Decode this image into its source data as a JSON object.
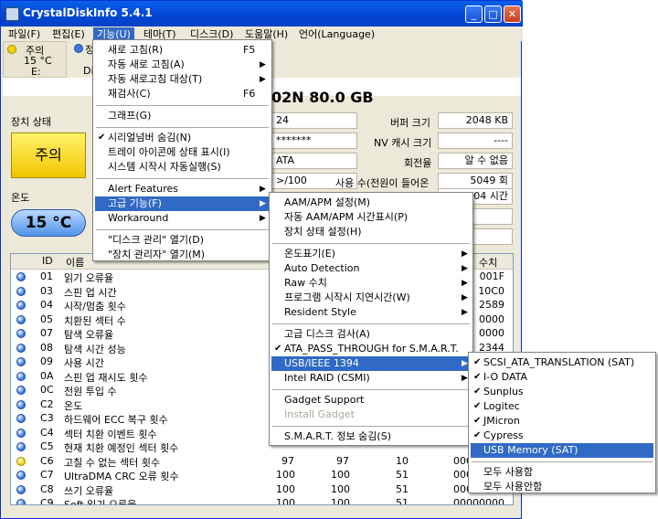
{
  "window": {
    "title": "CrystalDiskInfo 5.4.1",
    "minimize": "_",
    "maximize": "□",
    "close": "✕"
  },
  "menubar": [
    "파일(F)",
    "편집(E)",
    "기능(U)",
    "테마(T)",
    "디스크(D)",
    "도움말(H)",
    "언어(Language)"
  ],
  "disk_tabs": [
    {
      "status": "주의",
      "temp": "15 °C",
      "drive": "E:",
      "color": "#f5d000"
    },
    {
      "status": "정",
      "drive": "Di",
      "color": "#3a78e8"
    }
  ],
  "disk_title": "02N  80.0 GB",
  "left_panel": {
    "health_label": "장치 상태",
    "health_value": "주의",
    "temp_label": "온도",
    "temp_value": "15 °C"
  },
  "info_fields": {
    "col1": [
      "24",
      "*******",
      "ATA",
      ">/100"
    ],
    "col2_labels": [
      "버퍼 크기",
      "NV 캐시 크기",
      "회전율",
      "사용 수(전원이 들어온"
    ],
    "col2_values": [
      "2048 KB",
      "----",
      "알 수 없음",
      "5049 회"
    ],
    "partial_value": "04 시간"
  },
  "table": {
    "headers": [
      "ID",
      "이름",
      "수치"
    ],
    "rows": [
      {
        "id": "01",
        "name": "읽기 오류율",
        "raw": "001F",
        "color": "blue"
      },
      {
        "id": "03",
        "name": "스핀 업 시간",
        "raw": "10C0",
        "color": "blue"
      },
      {
        "id": "04",
        "name": "시작/멈춤 횟수",
        "raw": "2589",
        "color": "blue"
      },
      {
        "id": "05",
        "name": "치환된 섹터 수",
        "raw": "0000",
        "color": "blue"
      },
      {
        "id": "07",
        "name": "탐색 오류율",
        "raw": "0000",
        "color": "blue"
      },
      {
        "id": "08",
        "name": "탐색 시간 성능",
        "raw": "2344",
        "color": "blue"
      },
      {
        "id": "09",
        "name": "사용 시간",
        "raw": "",
        "color": "blue"
      },
      {
        "id": "0A",
        "name": "스핀 업 재시도 횟수",
        "raw": "",
        "color": "blue"
      },
      {
        "id": "0C",
        "name": "전원 투입 수",
        "raw": "",
        "color": "blue"
      },
      {
        "id": "C2",
        "name": "온도",
        "raw": "",
        "color": "blue"
      },
      {
        "id": "C3",
        "name": "하드웨어 ECC 복구 횟수",
        "raw": "",
        "color": "blue"
      },
      {
        "id": "C4",
        "name": "섹터 치환 이벤트 횟수",
        "raw": "",
        "color": "blue"
      },
      {
        "id": "C5",
        "name": "현재 치환 예정인 섹터 횟수",
        "raw": "",
        "color": "blue"
      },
      {
        "id": "C6",
        "name": "고칠 수 없는 섹터 횟수",
        "cur": "97",
        "worst": "97",
        "thr": "10",
        "raw": "00000000",
        "color": "yellow"
      },
      {
        "id": "C7",
        "name": "UltraDMA CRC 오류 횟수",
        "cur": "100",
        "worst": "100",
        "thr": "51",
        "raw": "00000000",
        "color": "blue"
      },
      {
        "id": "C8",
        "name": "쓰기 오류율",
        "cur": "100",
        "worst": "100",
        "thr": "51",
        "raw": "00000000",
        "color": "blue"
      },
      {
        "id": "C9",
        "name": "Soft 읽기 오류율",
        "cur": "100",
        "worst": "100",
        "thr": "51",
        "raw": "00000000",
        "color": "blue"
      }
    ]
  },
  "menu_func": [
    {
      "label": "새로 고침(R)",
      "shortcut": "F5"
    },
    {
      "label": "자동 새로 고침(A)",
      "arrow": true
    },
    {
      "label": "자동 새로고침 대상(T)",
      "arrow": true
    },
    {
      "label": "재검사(C)",
      "shortcut": "F6"
    },
    {
      "sep": true
    },
    {
      "label": "그래프(G)"
    },
    {
      "sep": true
    },
    {
      "label": "시리얼넘버 숨김(N)",
      "check": true
    },
    {
      "label": "트레이 아이콘에 상태 표시(I)"
    },
    {
      "label": "시스템 시작시 자동실행(S)"
    },
    {
      "sep": true
    },
    {
      "label": "Alert Features",
      "arrow": true
    },
    {
      "label": "고급 기능(F)",
      "arrow": true,
      "highlight": true
    },
    {
      "label": "Workaround",
      "arrow": true
    },
    {
      "sep": true
    },
    {
      "label": "\"디스크 관리\" 열기(D)"
    },
    {
      "label": "\"장치 관리자\" 열기(M)"
    }
  ],
  "menu_advanced": [
    {
      "label": "AAM/APM 설정(M)"
    },
    {
      "label": "자동 AAM/APM 시간표시(P)"
    },
    {
      "label": "장치 상태 설정(H)"
    },
    {
      "sep": true
    },
    {
      "label": "온도표기(E)",
      "arrow": true
    },
    {
      "label": "Auto Detection",
      "arrow": true
    },
    {
      "label": "Raw 수치",
      "arrow": true
    },
    {
      "label": "프로그램 시작시 지연시간(W)",
      "arrow": true
    },
    {
      "label": "Resident Style",
      "arrow": true
    },
    {
      "sep": true
    },
    {
      "label": "고급 디스크 검사(A)"
    },
    {
      "label": "ATA_PASS_THROUGH for S.M.A.R.T.",
      "check": true
    },
    {
      "label": "USB/IEEE 1394",
      "arrow": true,
      "highlight": true
    },
    {
      "label": "Intel RAID (CSMI)",
      "arrow": true
    },
    {
      "sep": true
    },
    {
      "label": "Gadget Support"
    },
    {
      "label": "Install Gadget",
      "disabled": true
    },
    {
      "sep": true
    },
    {
      "label": "S.M.A.R.T. 정보 숨김(S)"
    }
  ],
  "menu_usb": [
    {
      "label": "SCSI_ATA_TRANSLATION (SAT)",
      "check": true
    },
    {
      "label": "I-O DATA",
      "check": true
    },
    {
      "label": "Sunplus",
      "check": true
    },
    {
      "label": "Logitec",
      "check": true
    },
    {
      "label": "JMicron",
      "check": true
    },
    {
      "label": "Cypress",
      "check": true
    },
    {
      "label": "USB Memory (SAT)",
      "highlight": true
    },
    {
      "sep": true
    },
    {
      "label": "모두 사용함"
    },
    {
      "label": "모두 사용안함"
    }
  ],
  "colors": {
    "highlight": "#316ac5",
    "title_blue": "#0348d6",
    "caution_yellow": "#f5d000",
    "good_blue": "#3a78e8"
  }
}
